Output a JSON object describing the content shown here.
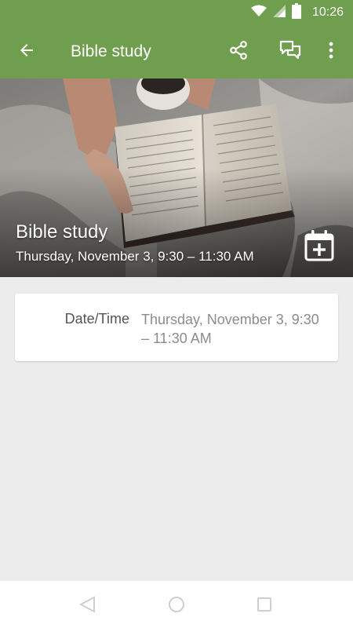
{
  "status_bar": {
    "time": "10:26",
    "icons": [
      "wifi-icon",
      "cellular-signal-icon",
      "battery-icon"
    ]
  },
  "app_bar": {
    "title": "Bible study",
    "actions": [
      "share-icon",
      "chat-icon",
      "more-vert-icon"
    ],
    "background_color": "#6f9e4f"
  },
  "hero": {
    "title": "Bible study",
    "subtitle": "Thursday, November 3, 9:30 – 11:30 AM",
    "image": "open-bible-on-blanket-photo",
    "action_icon": "calendar-add-icon"
  },
  "details": {
    "rows": [
      {
        "label": "Date/Time",
        "value": "Thursday, November 3, 9:30 – 11:30 AM"
      }
    ]
  },
  "nav_bar": {
    "buttons": [
      "back-triangle-icon",
      "home-circle-icon",
      "recents-square-icon"
    ]
  }
}
